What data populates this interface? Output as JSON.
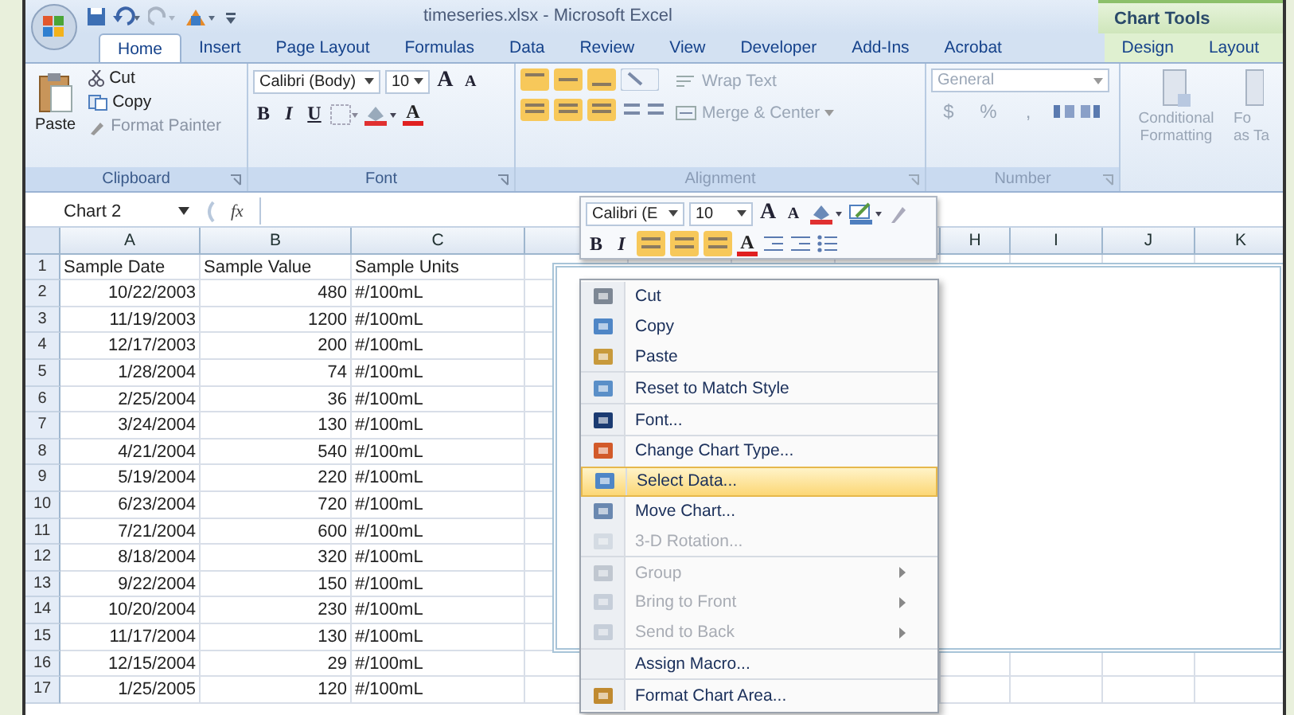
{
  "window": {
    "title": "timeseries.xlsx - Microsoft Excel",
    "context_group": "Chart Tools"
  },
  "tabs": [
    {
      "label": "Home",
      "selected": true,
      "contextual": false
    },
    {
      "label": "Insert",
      "selected": false,
      "contextual": false
    },
    {
      "label": "Page Layout",
      "selected": false,
      "contextual": false
    },
    {
      "label": "Formulas",
      "selected": false,
      "contextual": false
    },
    {
      "label": "Data",
      "selected": false,
      "contextual": false
    },
    {
      "label": "Review",
      "selected": false,
      "contextual": false
    },
    {
      "label": "View",
      "selected": false,
      "contextual": false
    },
    {
      "label": "Developer",
      "selected": false,
      "contextual": false
    },
    {
      "label": "Add-Ins",
      "selected": false,
      "contextual": false
    },
    {
      "label": "Acrobat",
      "selected": false,
      "contextual": false
    },
    {
      "label": "Design",
      "selected": false,
      "contextual": true
    },
    {
      "label": "Layout",
      "selected": false,
      "contextual": true
    }
  ],
  "ribbon": {
    "clipboard": {
      "paste": "Paste",
      "cut": "Cut",
      "copy": "Copy",
      "format_painter": "Format Painter",
      "label": "Clipboard"
    },
    "font": {
      "font_name": "Calibri (Body)",
      "font_size": "10",
      "grow": "A",
      "shrink": "A",
      "bold": "B",
      "italic": "I",
      "underline": "U",
      "font_color": "A",
      "label": "Font"
    },
    "alignment": {
      "wrap": "Wrap Text",
      "merge": "Merge & Center",
      "label": "Alignment",
      "disabled": true
    },
    "number": {
      "format": "General",
      "currency": "$",
      "percent": "%",
      "comma": ",",
      "label": "Number",
      "disabled": true
    },
    "styles": {
      "conditional": "Conditional Formatting",
      "format_table_line1": "Fo",
      "format_table_line2": "as Ta",
      "disabled": true
    }
  },
  "formula_bar": {
    "name_box": "Chart 2",
    "fx": "fx"
  },
  "sheet": {
    "columns": [
      {
        "label": "A"
      },
      {
        "label": "B"
      },
      {
        "label": "C"
      },
      {},
      {},
      {},
      {},
      {
        "label": "H"
      },
      {
        "label": "I"
      },
      {
        "label": "J"
      },
      {
        "label": "K"
      }
    ],
    "rows": [
      {
        "number": "1",
        "cells": [
          "Sample Date",
          "Sample Value",
          "Sample Units"
        ]
      },
      {
        "number": "2",
        "cells": [
          "10/22/2003",
          "480",
          "#/100mL"
        ]
      },
      {
        "number": "3",
        "cells": [
          "11/19/2003",
          "1200",
          "#/100mL"
        ]
      },
      {
        "number": "4",
        "cells": [
          "12/17/2003",
          "200",
          "#/100mL"
        ]
      },
      {
        "number": "5",
        "cells": [
          "1/28/2004",
          "74",
          "#/100mL"
        ]
      },
      {
        "number": "6",
        "cells": [
          "2/25/2004",
          "36",
          "#/100mL"
        ]
      },
      {
        "number": "7",
        "cells": [
          "3/24/2004",
          "130",
          "#/100mL"
        ]
      },
      {
        "number": "8",
        "cells": [
          "4/21/2004",
          "540",
          "#/100mL"
        ]
      },
      {
        "number": "9",
        "cells": [
          "5/19/2004",
          "220",
          "#/100mL"
        ]
      },
      {
        "number": "10",
        "cells": [
          "6/23/2004",
          "720",
          "#/100mL"
        ]
      },
      {
        "number": "11",
        "cells": [
          "7/21/2004",
          "600",
          "#/100mL"
        ]
      },
      {
        "number": "12",
        "cells": [
          "8/18/2004",
          "320",
          "#/100mL"
        ]
      },
      {
        "number": "13",
        "cells": [
          "9/22/2004",
          "150",
          "#/100mL"
        ]
      },
      {
        "number": "14",
        "cells": [
          "10/20/2004",
          "230",
          "#/100mL"
        ]
      },
      {
        "number": "15",
        "cells": [
          "11/17/2004",
          "130",
          "#/100mL"
        ]
      },
      {
        "number": "16",
        "cells": [
          "12/15/2004",
          "29",
          "#/100mL"
        ]
      },
      {
        "number": "17",
        "cells": [
          "1/25/2005",
          "120",
          "#/100mL"
        ]
      }
    ]
  },
  "mini_toolbar": {
    "font_name": "Calibri (E",
    "font_size": "10",
    "grow": "A",
    "shrink": "A",
    "bold": "B",
    "italic": "I",
    "font_color": "A"
  },
  "context_menu": [
    {
      "label": "Cut",
      "disabled": false,
      "selected": false,
      "submenu": false,
      "separator_after": false
    },
    {
      "label": "Copy",
      "disabled": false,
      "selected": false,
      "submenu": false,
      "separator_after": false
    },
    {
      "label": "Paste",
      "disabled": false,
      "selected": false,
      "submenu": false,
      "separator_after": true
    },
    {
      "label": "Reset to Match Style",
      "disabled": false,
      "selected": false,
      "submenu": false,
      "separator_after": true
    },
    {
      "label": "Font...",
      "disabled": false,
      "selected": false,
      "submenu": false,
      "separator_after": true
    },
    {
      "label": "Change Chart Type...",
      "disabled": false,
      "selected": false,
      "submenu": false,
      "separator_after": false
    },
    {
      "label": "Select Data...",
      "disabled": false,
      "selected": true,
      "submenu": false,
      "separator_after": false
    },
    {
      "label": "Move Chart...",
      "disabled": false,
      "selected": false,
      "submenu": false,
      "separator_after": false
    },
    {
      "label": "3-D Rotation...",
      "disabled": true,
      "selected": false,
      "submenu": false,
      "separator_after": true
    },
    {
      "label": "Group",
      "disabled": true,
      "selected": false,
      "submenu": true,
      "separator_after": false
    },
    {
      "label": "Bring to Front",
      "disabled": true,
      "selected": false,
      "submenu": true,
      "separator_after": false
    },
    {
      "label": "Send to Back",
      "disabled": true,
      "selected": false,
      "submenu": true,
      "separator_after": true
    },
    {
      "label": "Assign Macro...",
      "disabled": false,
      "selected": false,
      "submenu": false,
      "separator_after": true
    },
    {
      "label": "Format Chart Area...",
      "disabled": false,
      "selected": false,
      "submenu": false,
      "separator_after": false
    }
  ]
}
